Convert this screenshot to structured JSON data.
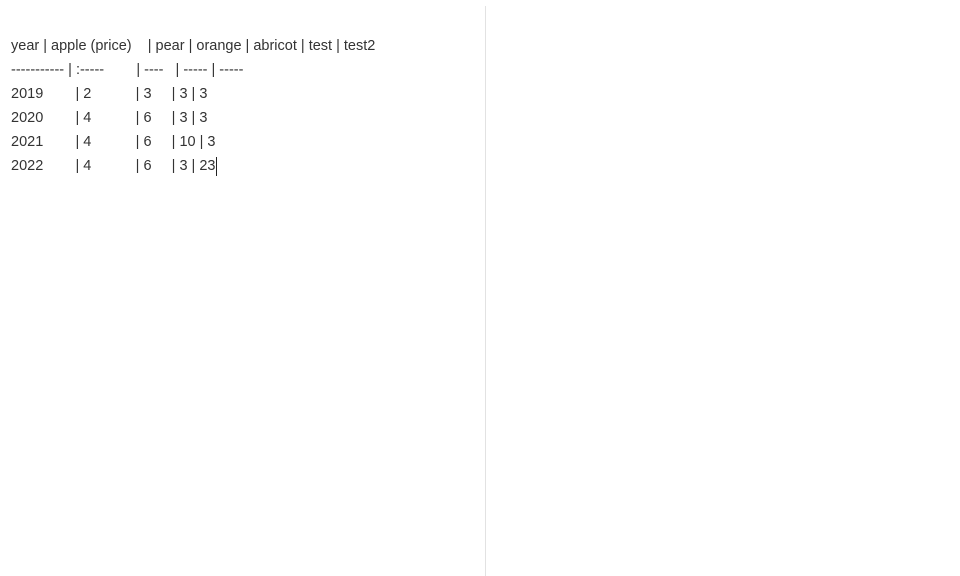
{
  "editor": {
    "lines": [
      "year | apple (price)    | pear | orange | abricot | test | test2",
      "----------- | :-----        | ----   | ----- | -----",
      "2019        | 2           | 3     | 3 | 3",
      "2020        | 4           | 6     | 3 | 3",
      "2021        | 4           | 6     | 10 | 3",
      "2022        | 4           | 6     | 3 | 23"
    ]
  }
}
